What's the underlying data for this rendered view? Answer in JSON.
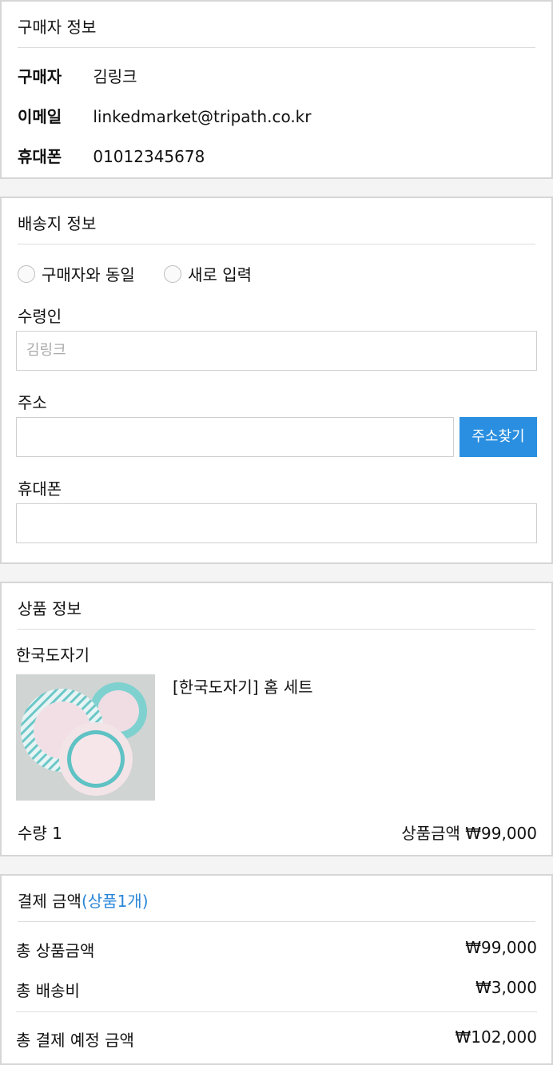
{
  "buyer": {
    "title": "구매자 정보",
    "name_label": "구매자",
    "name_value": "김링크",
    "email_label": "이메일",
    "email_value": "linkedmarket@tripath.co.kr",
    "phone_label": "휴대폰",
    "phone_value": "01012345678"
  },
  "shipping": {
    "title": "배송지 정보",
    "radio_same": "구매자와 동일",
    "radio_new": "새로 입력",
    "recipient_label": "수령인",
    "recipient_placeholder": "김링크",
    "address_label": "주소",
    "address_value": "",
    "address_button": "주소찾기",
    "phone_label": "휴대폰",
    "phone_value": ""
  },
  "product": {
    "title": "상품 정보",
    "brand": "한국도자기",
    "name": "[한국도자기] 홈 세트",
    "quantity": "수량 1",
    "price": "상품금액 ₩99,000"
  },
  "payment": {
    "title": "결제 금액",
    "title_count": "(상품1개)",
    "subtotal_label": "총 상품금액",
    "subtotal_value": "₩99,000",
    "shipping_label": "총 배송비",
    "shipping_value": "₩3,000",
    "total_label": "총 결제 예정 금액",
    "total_value": "₩102,000"
  },
  "colors": {
    "accent": "#2a86d8",
    "button": "#2a8fe0",
    "border": "#d6d6d6"
  }
}
